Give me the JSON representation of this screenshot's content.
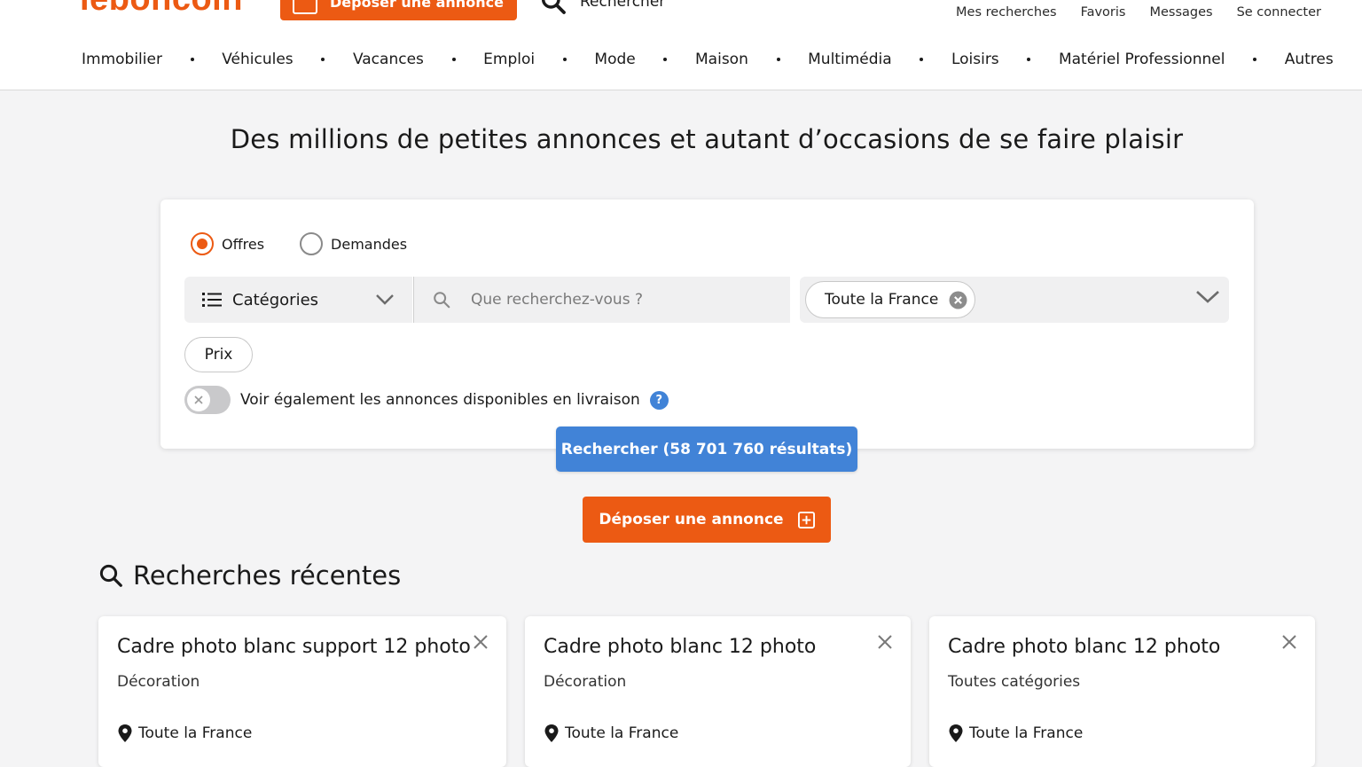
{
  "header": {
    "logo": "leboncoin",
    "deposit_label": "Déposer une annonce",
    "search_label": "Rechercher",
    "user_links": [
      "Mes recherches",
      "Favoris",
      "Messages",
      "Se connecter"
    ]
  },
  "categories_nav": [
    "Immobilier",
    "Véhicules",
    "Vacances",
    "Emploi",
    "Mode",
    "Maison",
    "Multimédia",
    "Loisirs",
    "Matériel Professionnel",
    "Autres"
  ],
  "headline": "Des millions de petites annonces et autant d’occasions de se faire plaisir",
  "search_form": {
    "radio_offres": "Offres",
    "radio_demandes": "Demandes",
    "selected_radio": "Offres",
    "category_select": "Catégories",
    "query_placeholder": "Que recherchez-vous ?",
    "query_value": "",
    "location_chip": "Toute la France",
    "price_label": "Prix",
    "toggle_label": "Voir également les annonces disponibles en livraison",
    "toggle_on": false,
    "help_symbol": "?",
    "search_button": "Rechercher (58 701 760 résultats)"
  },
  "deposit_button": "Déposer une annonce",
  "recent_searches": {
    "title": "Recherches récentes",
    "items": [
      {
        "title": "Cadre photo blanc support 12 photo",
        "category": "Décoration",
        "location": "Toute la France"
      },
      {
        "title": "Cadre photo blanc 12 photo",
        "category": "Décoration",
        "location": "Toute la France"
      },
      {
        "title": "Cadre photo blanc 12 photo",
        "category": "Toutes catégories",
        "location": "Toute la France"
      }
    ]
  },
  "colors": {
    "brand_orange": "#ec5a13",
    "primary_blue": "#4183d7",
    "background": "#f4f4f5"
  },
  "icons": {
    "search": "search-icon",
    "list": "list-icon",
    "chevron": "chevron-down-icon",
    "clear": "clear-circle-icon",
    "help": "help-icon",
    "plus": "plus-square-icon",
    "pin": "map-pin-icon",
    "close": "close-icon"
  }
}
